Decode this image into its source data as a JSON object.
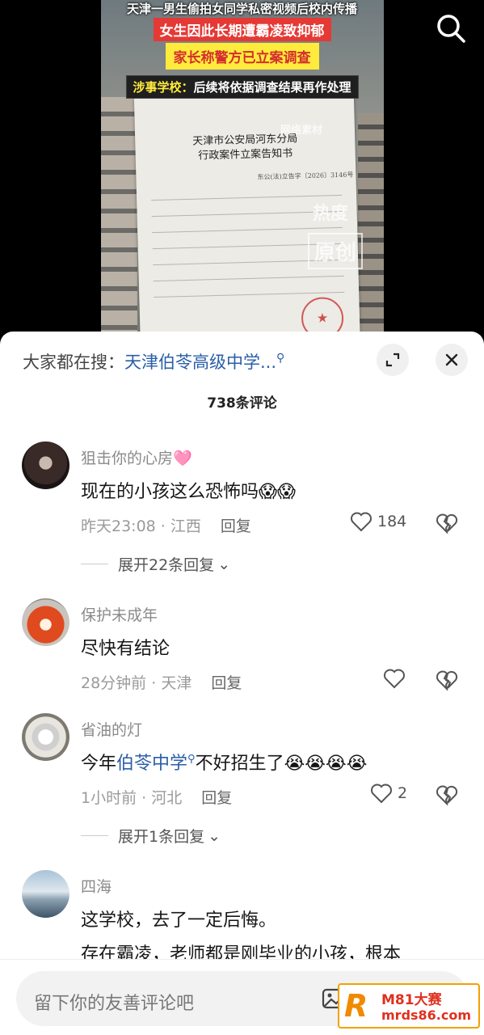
{
  "video": {
    "caption_line1": "天津一男生偷拍女同学私密视频后校内传播",
    "caption_line2": "女生因此长期遭霸凌致抑郁",
    "caption_line3": "家长称警方已立案调查",
    "caption_line4_prefix": "涉事学校：",
    "caption_line4_rest": "后续将依据调查结果再作处理",
    "watermark_material": "网络素材",
    "watermark_hot": "热度",
    "watermark_original": "原创",
    "document": {
      "title_line1": "天津市公安局河东分局",
      "title_line2": "行政案件立案告知书",
      "ref_no": "东公(法)立告字〔2026〕3146号"
    }
  },
  "sheet": {
    "hot_search_label": "大家都在搜：",
    "hot_search_query": "天津伯苓高级中学...",
    "comment_count": "738条评论"
  },
  "comments": [
    {
      "author": "狙击你的心房",
      "author_emoji": "🩷",
      "text": "现在的小孩这么恐怖吗",
      "emojis": "😱😱",
      "time": "昨天23:08",
      "location": "江西",
      "reply_label": "回复",
      "likes": "184",
      "expand": "展开22条回复"
    },
    {
      "author": "保护未成年",
      "text": "尽快有结论",
      "time": "28分钟前",
      "location": "天津",
      "reply_label": "回复",
      "likes": ""
    },
    {
      "author": "省油的灯",
      "text_prefix": "今年",
      "text_link": "伯苓中学",
      "text_suffix": "不好招生了",
      "emojis": "😭😭😭😭",
      "time": "1小时前",
      "location": "河北",
      "reply_label": "回复",
      "likes": "2",
      "expand": "展开1条回复"
    },
    {
      "author": "四海",
      "text_line1": "这学校，去了一定后悔。",
      "text_line2": "存在霸凌，老师都是刚毕业的小孩，根本"
    }
  ],
  "bottom": {
    "input_placeholder": "留下你的友善评论吧"
  },
  "brand": {
    "letter": "R",
    "name": "M81大赛",
    "url": "mrds86.com"
  }
}
